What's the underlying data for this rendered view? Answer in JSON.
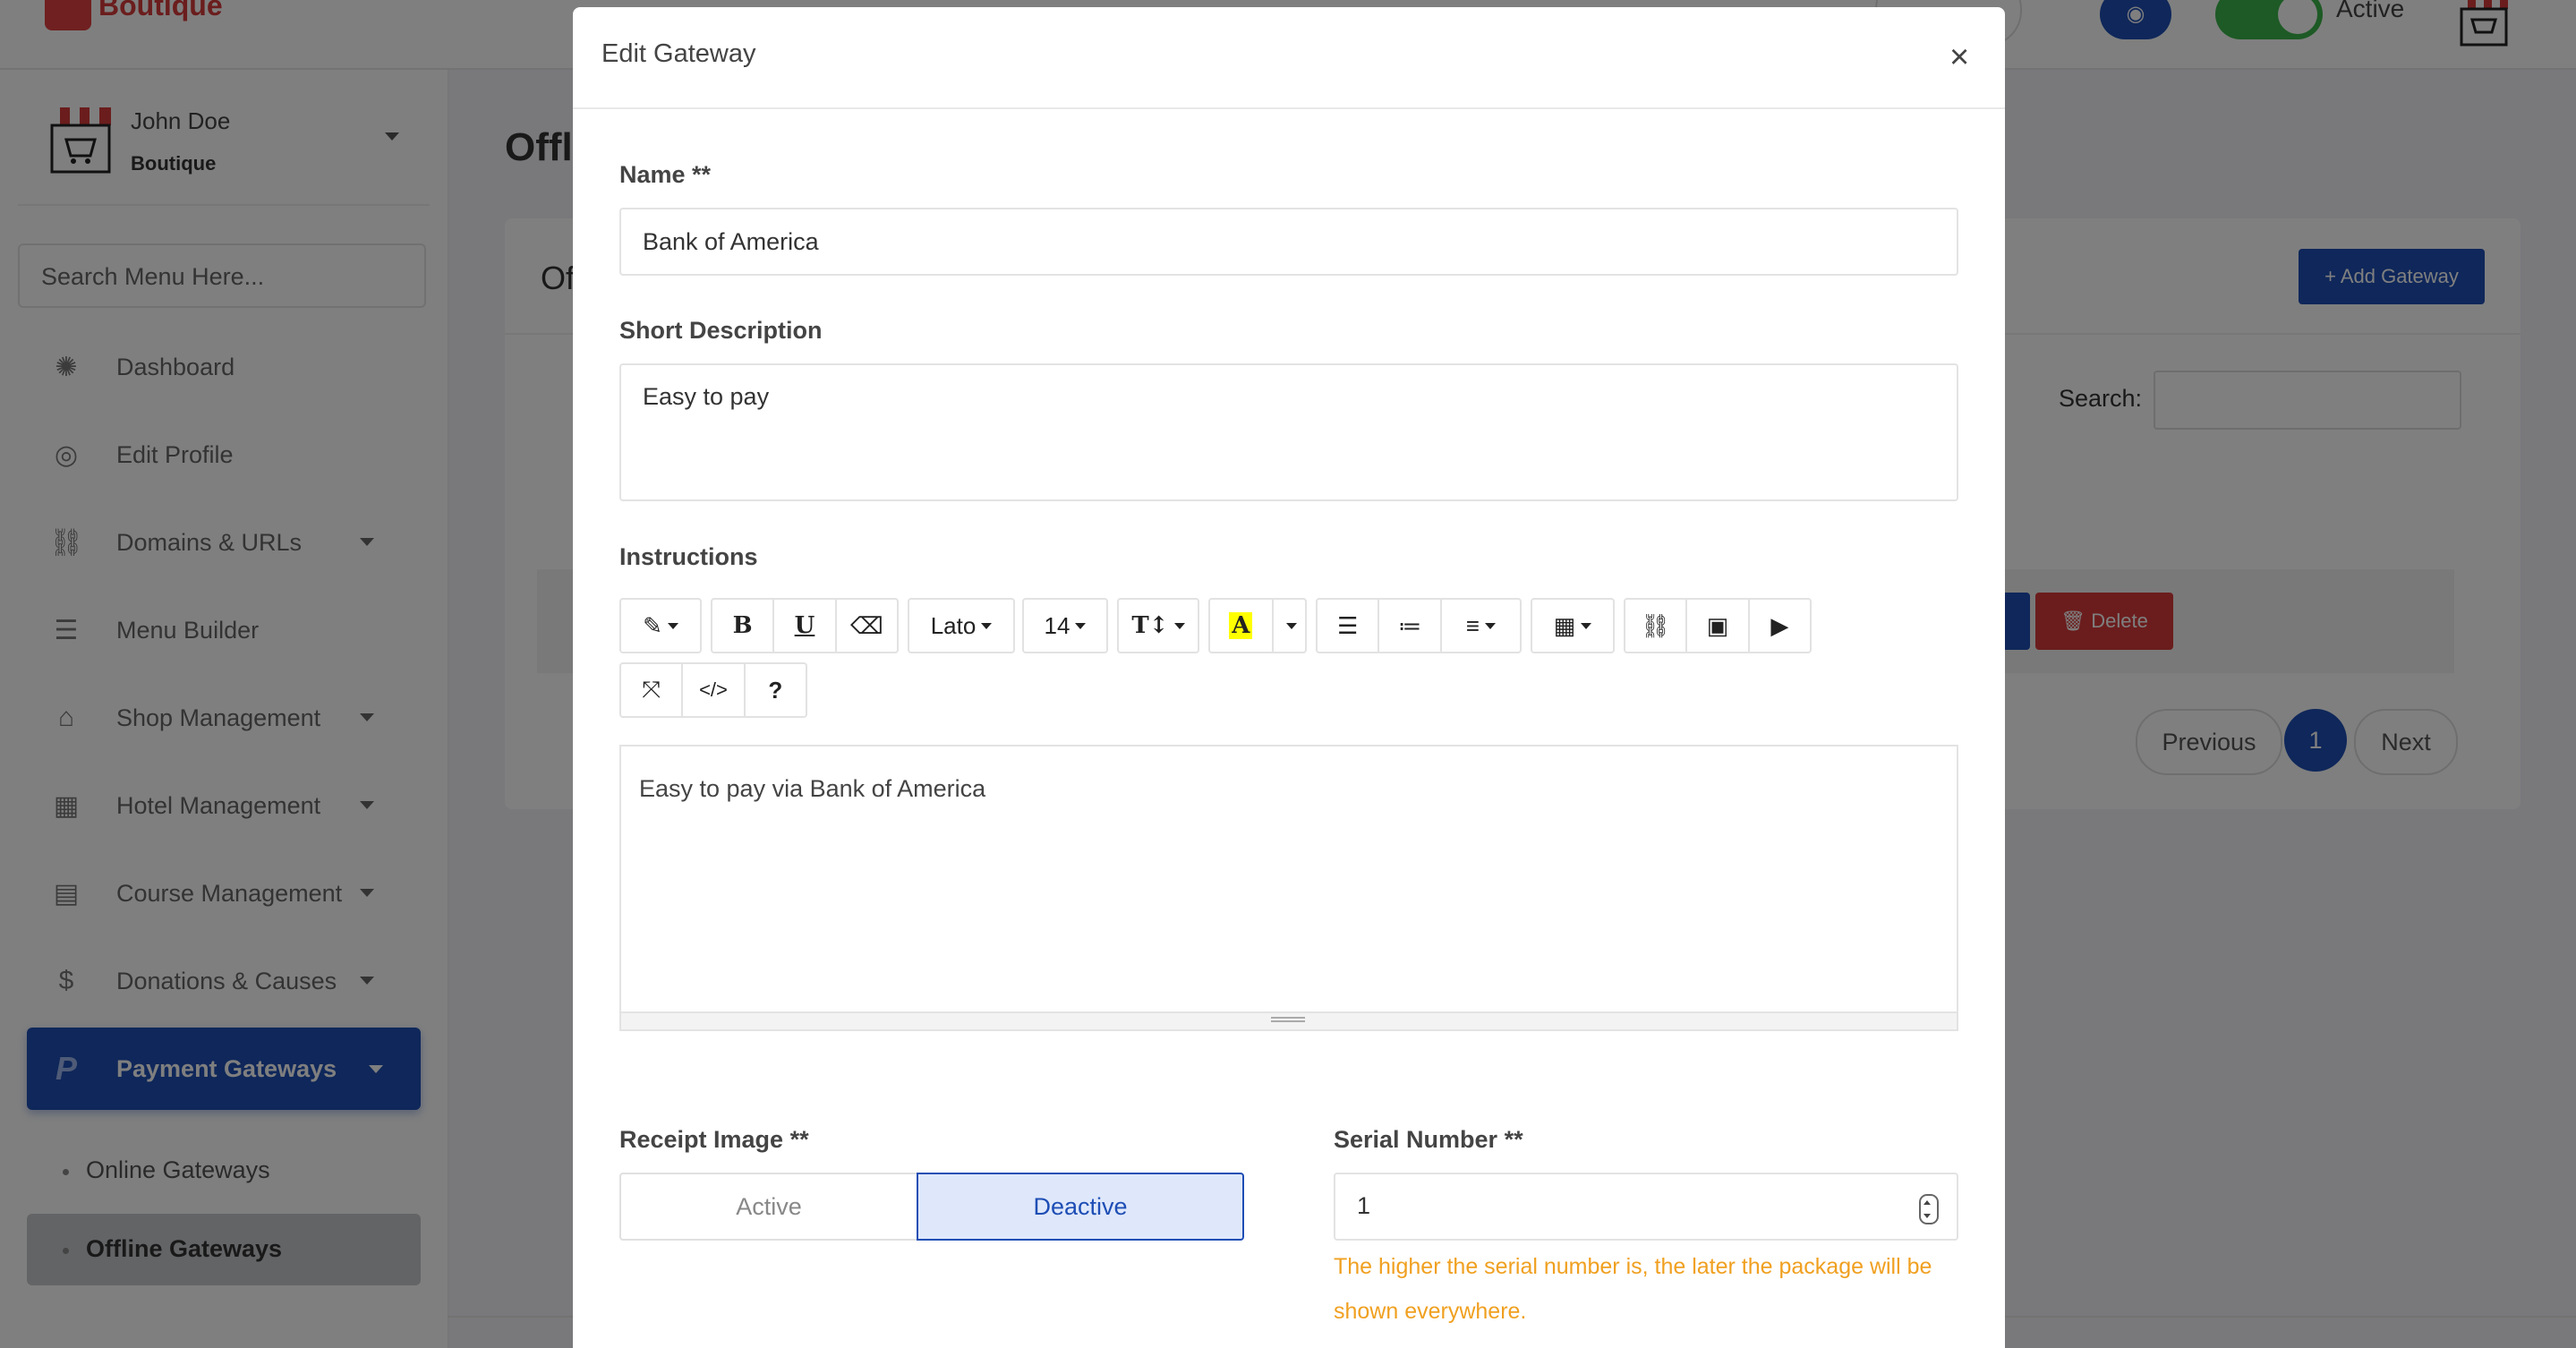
{
  "brand": {
    "name": "Boutique"
  },
  "topbar": {
    "status_label": "Active"
  },
  "sidebar": {
    "user_name": "John Doe",
    "user_shop": "Boutique",
    "search_placeholder": "Search Menu Here...",
    "items": [
      {
        "label": "Dashboard",
        "icon": "palette-icon"
      },
      {
        "label": "Edit Profile",
        "icon": "user-circle-icon"
      },
      {
        "label": "Domains & URLs",
        "icon": "link-icon"
      },
      {
        "label": "Menu Builder",
        "icon": "bars-icon"
      },
      {
        "label": "Shop Management",
        "icon": "store-icon"
      },
      {
        "label": "Hotel Management",
        "icon": "building-icon"
      },
      {
        "label": "Course Management",
        "icon": "book-icon"
      },
      {
        "label": "Donations & Causes",
        "icon": "donate-icon"
      },
      {
        "label": "Payment Gateways",
        "icon": "paypal-icon"
      }
    ],
    "sub_items": [
      {
        "label": "Online Gateways"
      },
      {
        "label": "Offline Gateways"
      }
    ]
  },
  "page": {
    "title": "Offl",
    "card_title": "Of",
    "add_button": "+ Add Gateway",
    "search_label": "Search:",
    "delete_button": "Delete",
    "pagination": {
      "prev": "Previous",
      "current": "1",
      "next": "Next"
    }
  },
  "modal": {
    "title": "Edit Gateway",
    "close": "×",
    "name_label": "Name **",
    "name_value": "Bank of America",
    "short_desc_label": "Short Description",
    "short_desc_value": "Easy to pay",
    "instructions_label": "Instructions",
    "toolbar": {
      "font": "Lato",
      "size": "14"
    },
    "editor_content": "Easy to pay via Bank of America",
    "receipt_label": "Receipt Image **",
    "receipt_options": {
      "active": "Active",
      "deactive": "Deactive"
    },
    "serial_label": "Serial Number **",
    "serial_value": "1",
    "serial_hint": "The higher the serial number is, the later the package will be shown everywhere."
  },
  "colors": {
    "primary": "#1e4eb5",
    "danger": "#d63a3a",
    "warning": "#f0a020",
    "success": "#3bb54a"
  }
}
